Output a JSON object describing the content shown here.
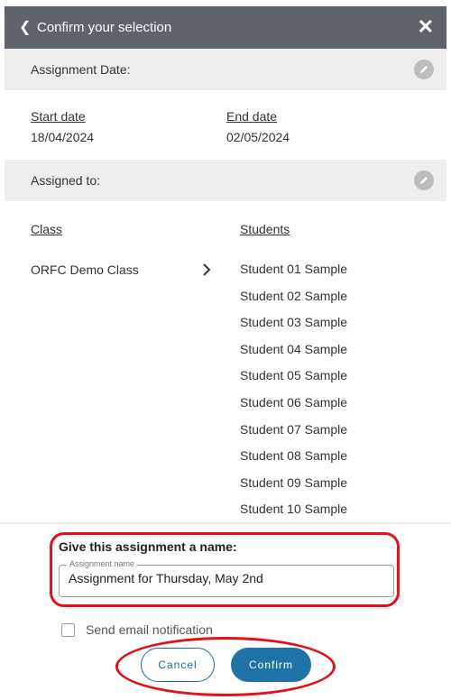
{
  "header": {
    "title": "Confirm your selection",
    "back_icon": "chevron-left-icon",
    "close_icon": "close-icon"
  },
  "assignment_date": {
    "label": "Assignment Date:",
    "start_label": "Start date",
    "start_value": "18/04/2024",
    "end_label": "End date",
    "end_value": "02/05/2024"
  },
  "assigned_to": {
    "label": "Assigned to:",
    "class_header": "Class",
    "students_header": "Students",
    "class_name": "ORFC Demo Class",
    "students": [
      "Student 01 Sample",
      "Student 02 Sample",
      "Student 03 Sample",
      "Student 04 Sample",
      "Student 05 Sample",
      "Student 06 Sample",
      "Student 07 Sample",
      "Student 08 Sample",
      "Student 09 Sample",
      "Student 10 Sample"
    ]
  },
  "naming": {
    "title": "Give this assignment a name:",
    "field_label": "Assignment name",
    "field_value": "Assignment for Thursday, May 2nd"
  },
  "email_notification": {
    "label": "Send email notification",
    "checked": false
  },
  "buttons": {
    "cancel": "Cancel",
    "confirm": "Confirm"
  },
  "colors": {
    "header_bg": "#5e646a",
    "section_bg": "#eeeeee",
    "primary": "#1f73a6",
    "highlight_annotation": "#e2121c"
  }
}
